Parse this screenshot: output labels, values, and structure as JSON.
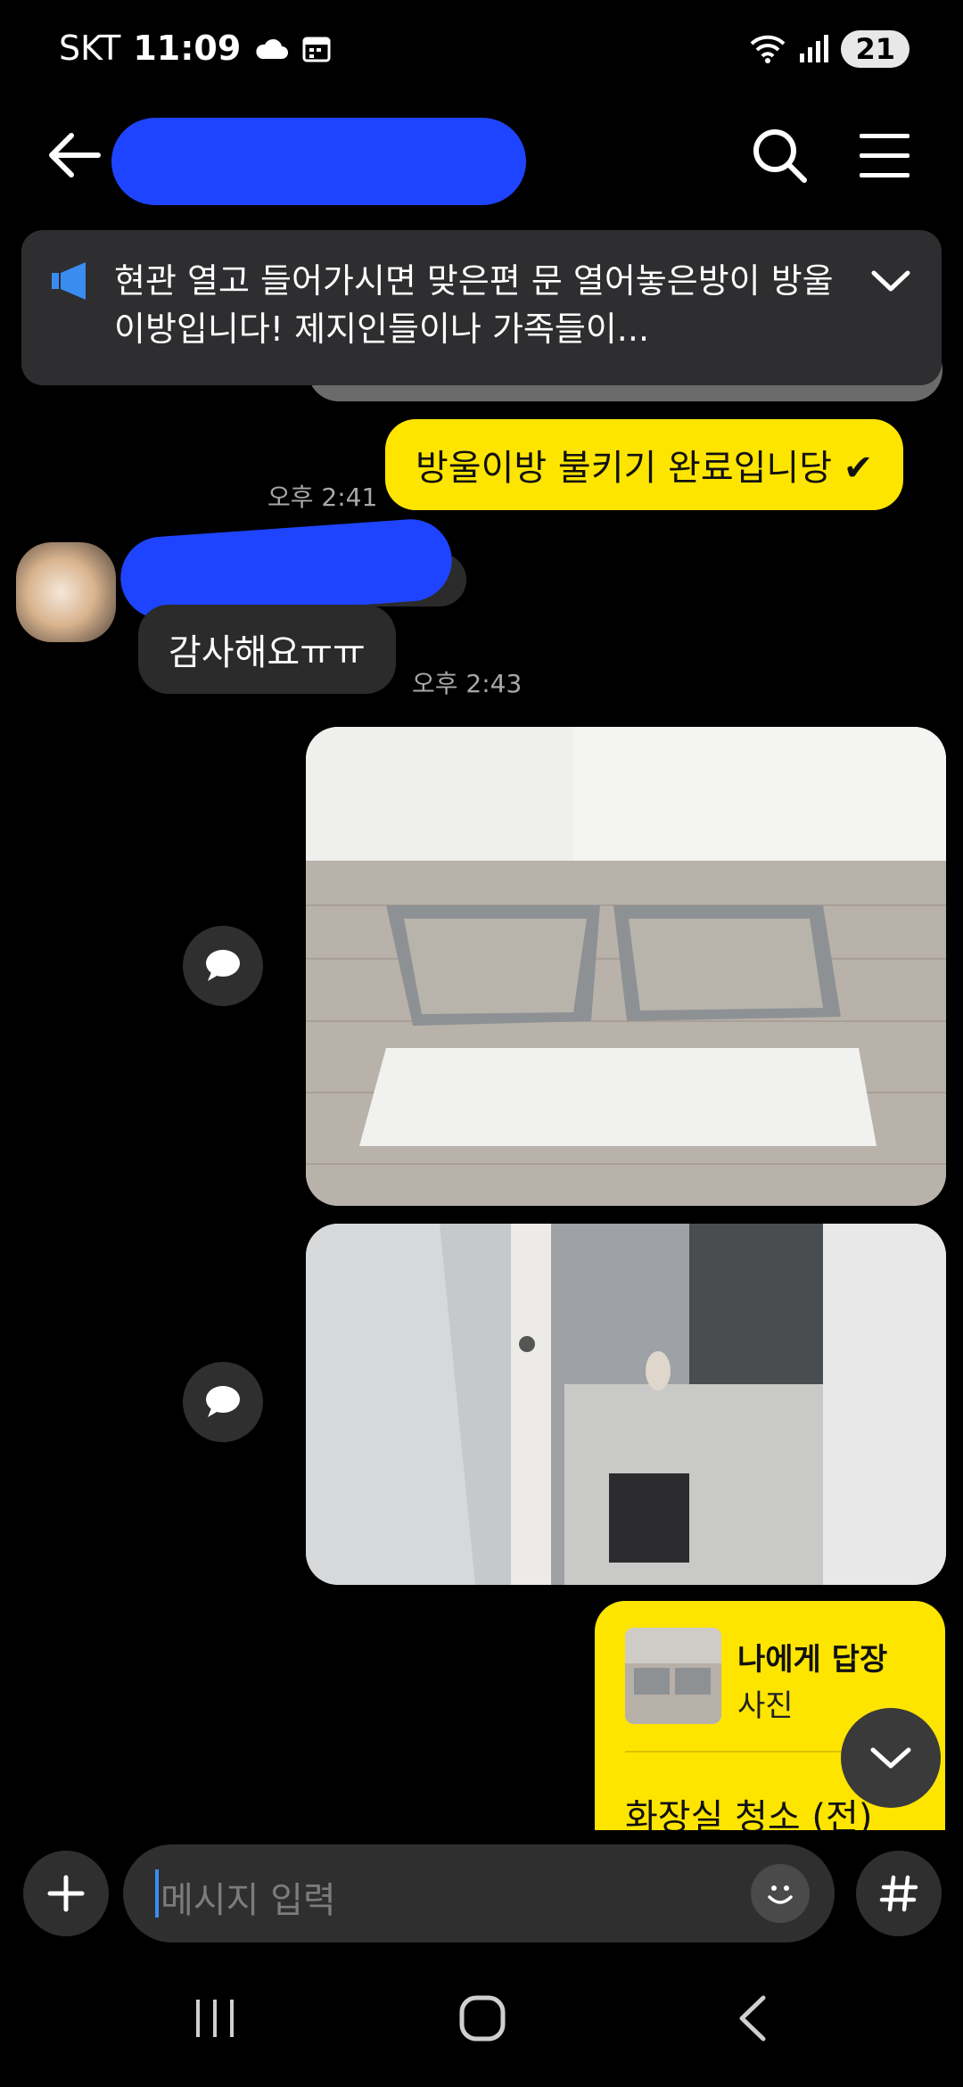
{
  "status_bar": {
    "carrier": "SKT",
    "time": "11:09",
    "battery": "21"
  },
  "header": {
    "title": ""
  },
  "notice": {
    "text": "현관 열고 들어가시면 맞은편 문 열어놓은방이 방울이방입니다! 제지인들이나 가족들이..."
  },
  "messages": {
    "sent_1": {
      "text": "방울이방 불키기 완료입니당 ✔",
      "time": "오후 2:41"
    },
    "recv_1": {
      "text": "감사해요ㅠㅠ",
      "time": "오후 2:43"
    },
    "reply": {
      "title": "나에게 답장",
      "subtitle": "사진",
      "text": "화장실 청소 (전)"
    }
  },
  "input": {
    "placeholder": "메시지 입력"
  },
  "colors": {
    "accent_yellow": "#fee500",
    "background": "#000000",
    "bubble_dark": "#2b2b2b"
  }
}
